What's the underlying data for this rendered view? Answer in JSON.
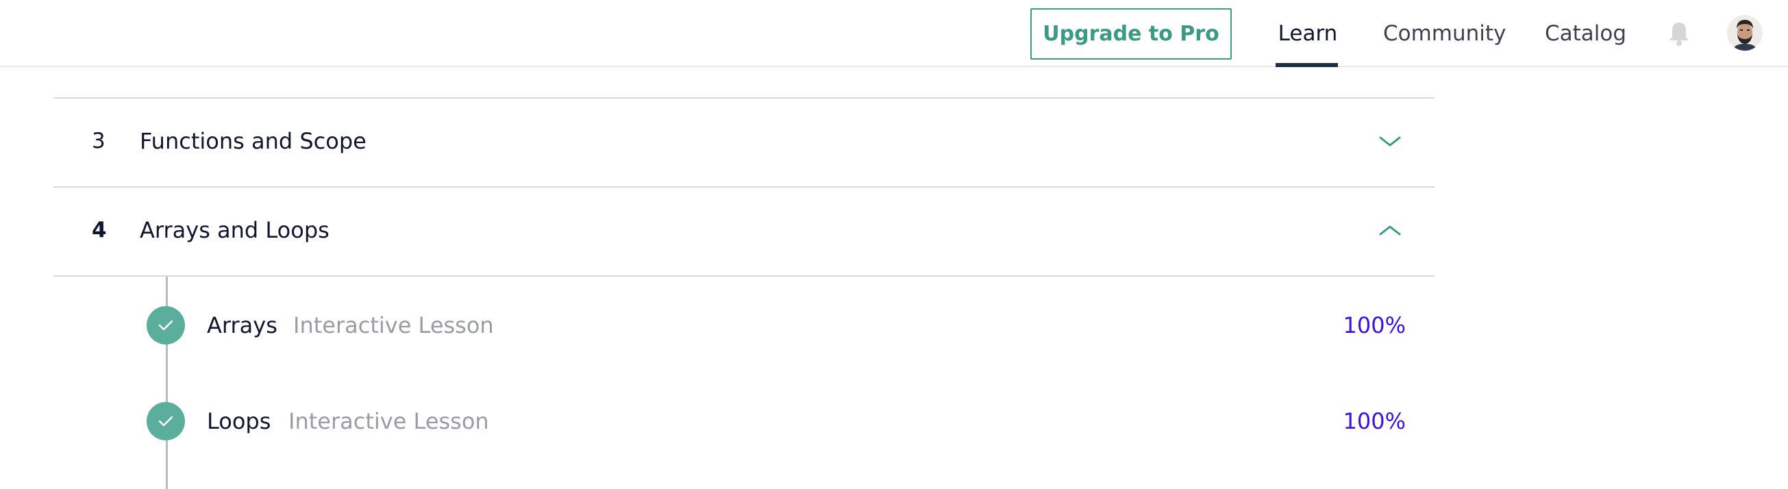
{
  "nav": {
    "upgrade_label": "Upgrade to Pro",
    "links": [
      "Learn",
      "Community",
      "Catalog"
    ],
    "active_link": "Learn"
  },
  "modules": [
    {
      "number": "3",
      "title": "Functions and Scope",
      "state": "collapsed"
    },
    {
      "number": "4",
      "title": "Arrays and Loops",
      "state": "expanded"
    }
  ],
  "lessons": [
    {
      "title": "Arrays",
      "type": "Interactive Lesson",
      "progress": "100%",
      "completed": true
    },
    {
      "title": "Loops",
      "type": "Interactive Lesson",
      "progress": "100%",
      "completed": true
    }
  ],
  "colors": {
    "accent": "#3a9b85",
    "check": "#5aae9b",
    "progress": "#3a10e5",
    "text": "#10162f"
  }
}
